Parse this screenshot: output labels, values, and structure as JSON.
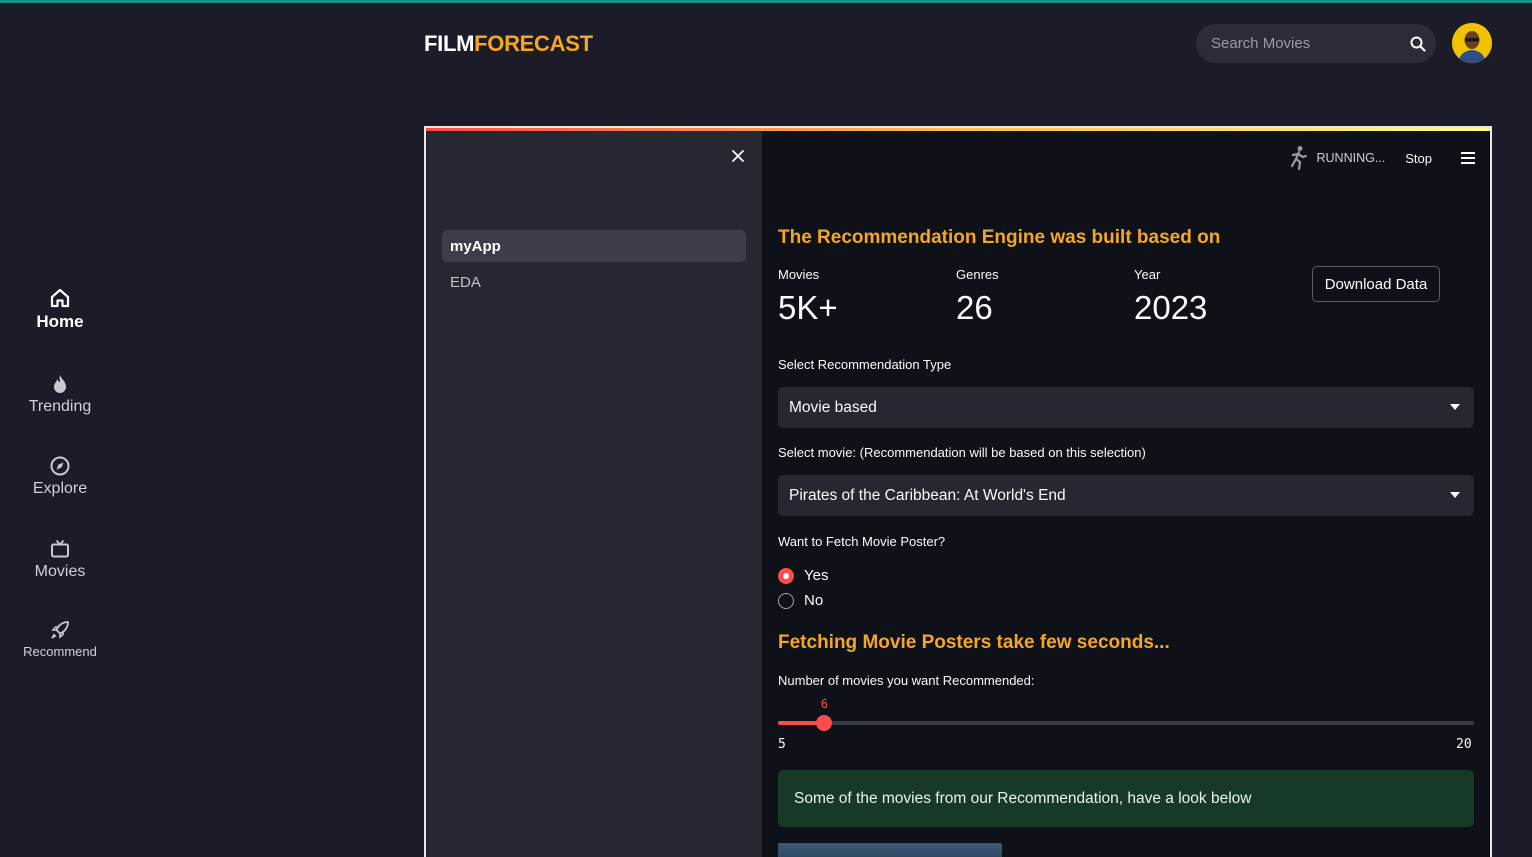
{
  "header": {
    "logo_part1": "FILM",
    "logo_part2": "FORECAST",
    "search_placeholder": "Search Movies"
  },
  "nav": {
    "items": [
      {
        "label": "Home",
        "icon": "home-icon",
        "active": true
      },
      {
        "label": "Trending",
        "icon": "flame-icon"
      },
      {
        "label": "Explore",
        "icon": "compass-icon"
      },
      {
        "label": "Movies",
        "icon": "tv-icon"
      },
      {
        "label": "Recommend",
        "icon": "rocket-icon"
      }
    ]
  },
  "app": {
    "sidebar": {
      "pages": [
        {
          "label": "myApp",
          "active": true
        },
        {
          "label": "EDA"
        }
      ]
    },
    "status": {
      "running_label": "RUNNING...",
      "stop_label": "Stop"
    },
    "heading": "The Recommendation Engine was built based on",
    "metrics": [
      {
        "label": "Movies",
        "value": "5K+"
      },
      {
        "label": "Genres",
        "value": "26"
      },
      {
        "label": "Year",
        "value": "2023"
      }
    ],
    "download_button": "Download Data",
    "rec_type": {
      "label": "Select Recommendation Type",
      "value": "Movie based"
    },
    "movie_select": {
      "label": "Select movie: (Recommendation will be based on this selection)",
      "value": "Pirates of the Caribbean: At World's End"
    },
    "poster_question": {
      "label": "Want to Fetch Movie Poster?",
      "options": [
        "Yes",
        "No"
      ],
      "selected": "Yes"
    },
    "fetching_heading": "Fetching Movie Posters take few seconds...",
    "slider": {
      "label": "Number of movies you want Recommended:",
      "value": "6",
      "min": "5",
      "max": "20"
    },
    "success_message": "Some of the movies from our Recommendation, have a look below"
  },
  "colors": {
    "accent_orange": "#f5a623",
    "streamlit_red": "#ff4b4b",
    "success_bg": "#173928"
  }
}
